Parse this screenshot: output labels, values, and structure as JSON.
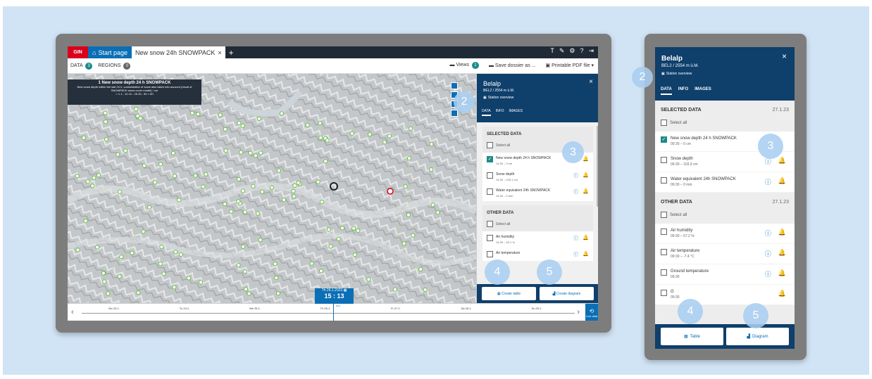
{
  "desktop": {
    "tabbar": {
      "brand": "GIN",
      "start_tab": "Start page",
      "active_tab": "New snow 24h SNOWPACK",
      "close": "×",
      "add": "+",
      "icons": [
        "T",
        "wrench-icon",
        "gear-icon",
        "help-icon",
        "logout-icon"
      ]
    },
    "toolbar": {
      "data_label": "DATA",
      "data_count": "3",
      "regions_label": "REGIONS",
      "regions_count": "0",
      "views_label": "Views",
      "views_count": "1",
      "save_label": "Save dossier as ...",
      "pdf_label": "Printable PDF file"
    },
    "legend": {
      "number": "1",
      "title": "New snow depth 24 h SNOWPACK",
      "subtitle": "New snow depth within the last 24 h, consolidation of snow also taken into account (result of SNOWPACK snow cover model) / cm",
      "bins": [
        "< 1",
        "1 - 10",
        "10 - 25",
        "25 - 50",
        "> 50"
      ]
    },
    "timeline": {
      "days": [
        "Mo 23.1.",
        "Tu 24.1.",
        "We 25.1.",
        "Th 26.1.",
        "Fr 27.1.",
        "Sa 28.1.",
        "Su 29.1."
      ],
      "current_date": "Th 26.1.2023",
      "current_time": "15 : 13",
      "now": "Now",
      "live_label": "Live data"
    },
    "panel": {
      "station": "Belalp",
      "elevation": "BEL2 / 2554 m ü.M.",
      "overview": "Station overview",
      "close": "×",
      "tabs": [
        "DATA",
        "INFO",
        "IMAGES"
      ],
      "selected_title": "SELECTED DATA",
      "other_title": "OTHER DATA",
      "select_all": "Select all",
      "selected_items": [
        {
          "label": "New snow depth 24 h SNOWPACK",
          "value": "14:30 – 0 cm",
          "checked": true
        },
        {
          "label": "Snow depth",
          "value": "14:30 – 100.1 cm",
          "checked": false
        },
        {
          "label": "Water equivalent 24h SNOWPACK",
          "value": "14:30 – 0 mm",
          "checked": false
        }
      ],
      "other_items": [
        {
          "label": "Air humidity",
          "value": "14:30 – 53.1 %"
        },
        {
          "label": "Air temperature",
          "value": ""
        }
      ],
      "table_button": "Create table",
      "diagram_button": "Create diagram"
    }
  },
  "mobile": {
    "station": "Belalp",
    "elevation": "BEL2 / 2554 m ü.M.",
    "overview": "Station overview",
    "close": "×",
    "tabs": [
      "DATA",
      "INFO",
      "IMAGES"
    ],
    "selected_title": "SELECTED DATA",
    "selected_date": "27.1.23",
    "other_title": "OTHER DATA",
    "other_date": "27.1.23",
    "select_all": "Select all",
    "selected_items": [
      {
        "label": "New snow depth 24 h SNOWPACK",
        "value": "09:30 – 0 cm",
        "checked": true
      },
      {
        "label": "Snow depth",
        "value": "09:30 – 103.9 cm",
        "checked": false
      },
      {
        "label": "Water equivalent 24h SNOWPACK",
        "value": "09:30 – 0 mm",
        "checked": false
      }
    ],
    "other_items": [
      {
        "label": "Air humidity",
        "value": "09:30 – 57.2 %"
      },
      {
        "label": "Air temperature",
        "value": "09:30 – -7.4 °C"
      },
      {
        "label": "Ground temperature",
        "value": "09:30"
      },
      {
        "label": "G",
        "value": "09:30"
      }
    ],
    "table_button": "Table",
    "diagram_button": "Diagram"
  },
  "callouts": [
    "2",
    "3",
    "4",
    "5",
    "2",
    "3",
    "4",
    "5"
  ],
  "colors": {
    "accent": "#0b6fb5",
    "panel_header": "#0f3f6b",
    "brand_red": "#d8001b",
    "teal": "#1b8a8a",
    "background": "#d1e4f5"
  }
}
